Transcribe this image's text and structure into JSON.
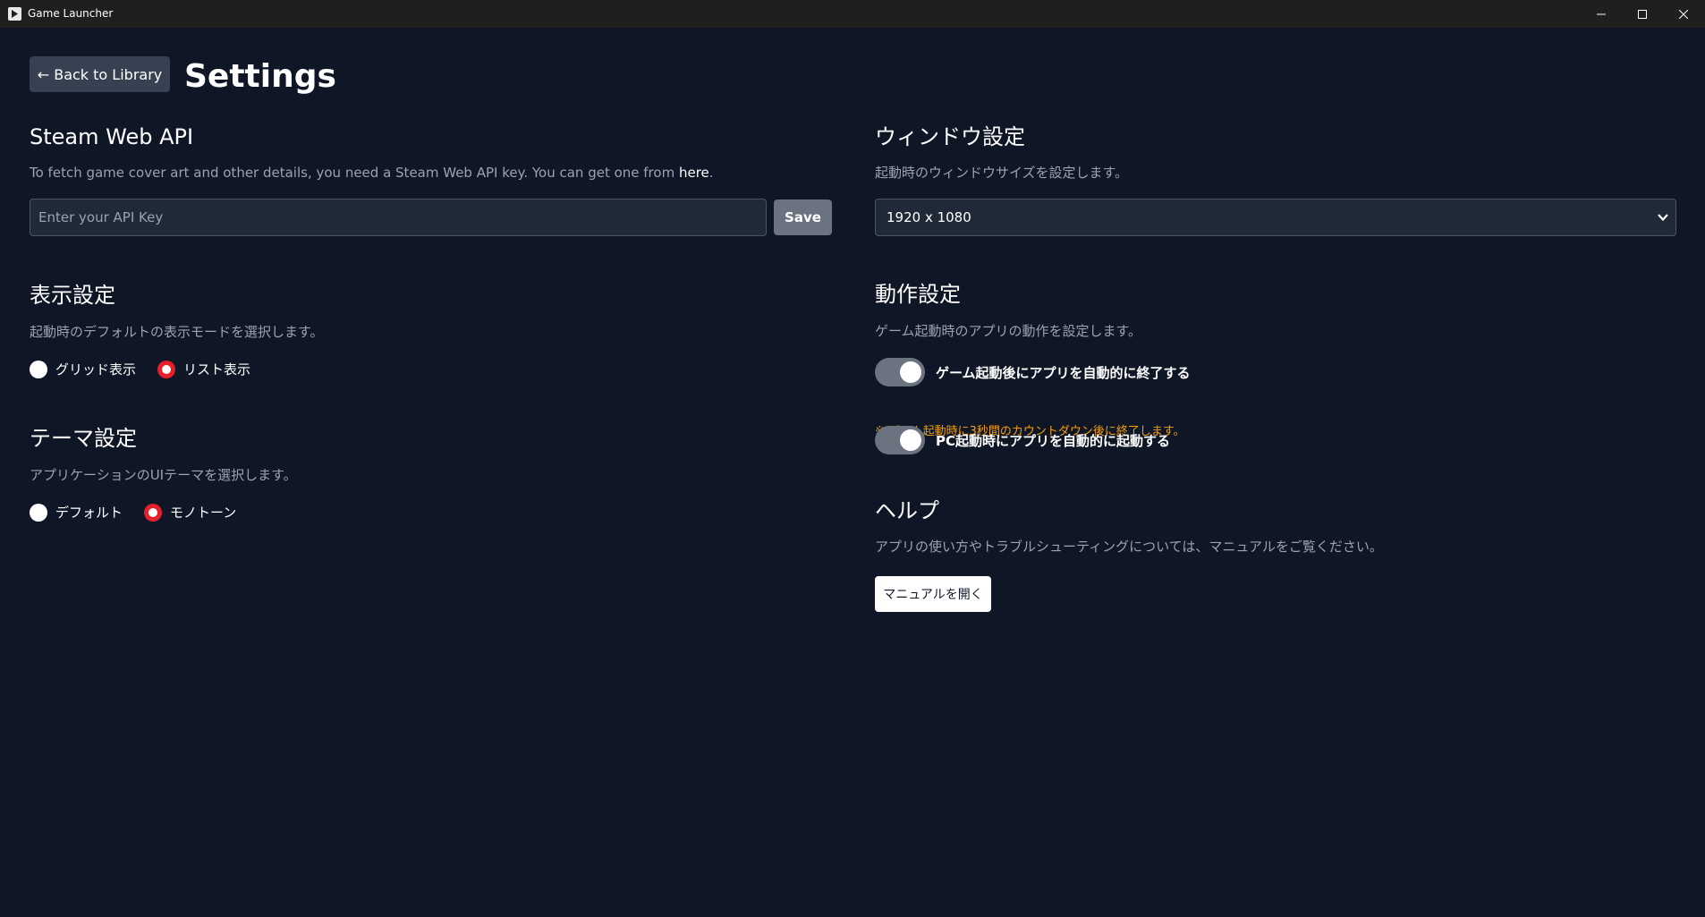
{
  "window": {
    "title": "Game Launcher"
  },
  "header": {
    "back_label": "← Back to Library",
    "page_title": "Settings"
  },
  "steam_api": {
    "title": "Steam Web API",
    "description": "To fetch game cover art and other details, you need a Steam Web API key. You can get one from ",
    "link_text": "here",
    "description_end": ".",
    "input_placeholder": "Enter your API Key",
    "input_value": "",
    "save_label": "Save"
  },
  "display": {
    "title": "表示設定",
    "description": "起動時のデフォルトの表示モードを選択します。",
    "options": [
      {
        "label": "グリッド表示",
        "checked": false
      },
      {
        "label": "リスト表示",
        "checked": true
      }
    ]
  },
  "theme": {
    "title": "テーマ設定",
    "description": "アプリケーションのUIテーマを選択します。",
    "options": [
      {
        "label": "デフォルト",
        "checked": false
      },
      {
        "label": "モノトーン",
        "checked": true
      }
    ]
  },
  "window_settings": {
    "title": "ウィンドウ設定",
    "description": "起動時のウィンドウサイズを設定します。",
    "selected": "1920 x 1080"
  },
  "behavior": {
    "title": "動作設定",
    "description": "ゲーム起動時のアプリの動作を設定します。",
    "toggles": [
      {
        "label": "ゲーム起動後にアプリを自動的に終了する",
        "on": true
      },
      {
        "label": "PC起動時にアプリを自動的に起動する",
        "on": true
      }
    ],
    "note": "※ ゲーム起動時に3秒間のカウントダウン後に終了します。"
  },
  "help": {
    "title": "ヘルプ",
    "description": "アプリの使い方やトラブルシューティングについては、マニュアルをご覧ください。",
    "button_label": "マニュアルを開く"
  },
  "colors": {
    "background": "#0f1626",
    "accent_radio": "#e5202b",
    "note": "#f59e0b"
  }
}
